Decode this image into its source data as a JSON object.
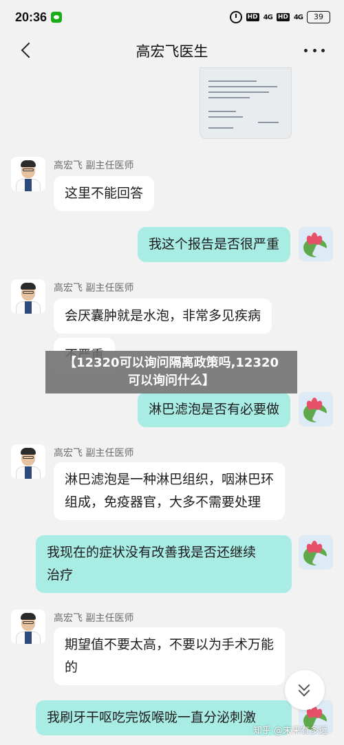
{
  "status_bar": {
    "time": "20:36",
    "hd1": "HD",
    "signal1": "4G",
    "hd2": "HD",
    "signal2": "4G",
    "battery": "39"
  },
  "header": {
    "title": "高宏飞医生"
  },
  "doctor": {
    "name_line": "高宏飞  副主任医师"
  },
  "messages": [
    {
      "from": "doctor",
      "text": "这里不能回答"
    },
    {
      "from": "me",
      "text": "我这个报告是否很严重"
    },
    {
      "from": "doctor",
      "text": "会厌囊肿就是水泡，非常多见疾病"
    },
    {
      "from": "doctor",
      "text": "不严重"
    },
    {
      "from": "me",
      "text": "淋巴滤泡是否有必要做"
    },
    {
      "from": "doctor",
      "lines": [
        "淋巴滤泡是一种淋巴组织，咽淋巴环",
        "组成，免疫器官，大多不需要处理"
      ]
    },
    {
      "from": "me",
      "lines": [
        "我现在的症状没有改善我是否还继续",
        "治疗"
      ]
    },
    {
      "from": "doctor",
      "lines": [
        "期望值不要太高，不要以为手术万能",
        "的"
      ]
    },
    {
      "from": "me",
      "text": "我刷牙干呕吃完饭喉咙一直分泌刺激"
    }
  ],
  "overlay": {
    "line1": "【12320可以询问隔离政策吗,12320",
    "line2": "可以询问什么】"
  },
  "watermark": "知乎 @未来有多远",
  "icons": [
    "back-arrow-icon",
    "more-icon",
    "alarm-icon",
    "wechat-icon",
    "chevron-double-down-icon"
  ],
  "colors": {
    "my_bubble": "#a8ece3",
    "doctor_bubble": "#ffffff",
    "background": "#f2f2f2"
  }
}
